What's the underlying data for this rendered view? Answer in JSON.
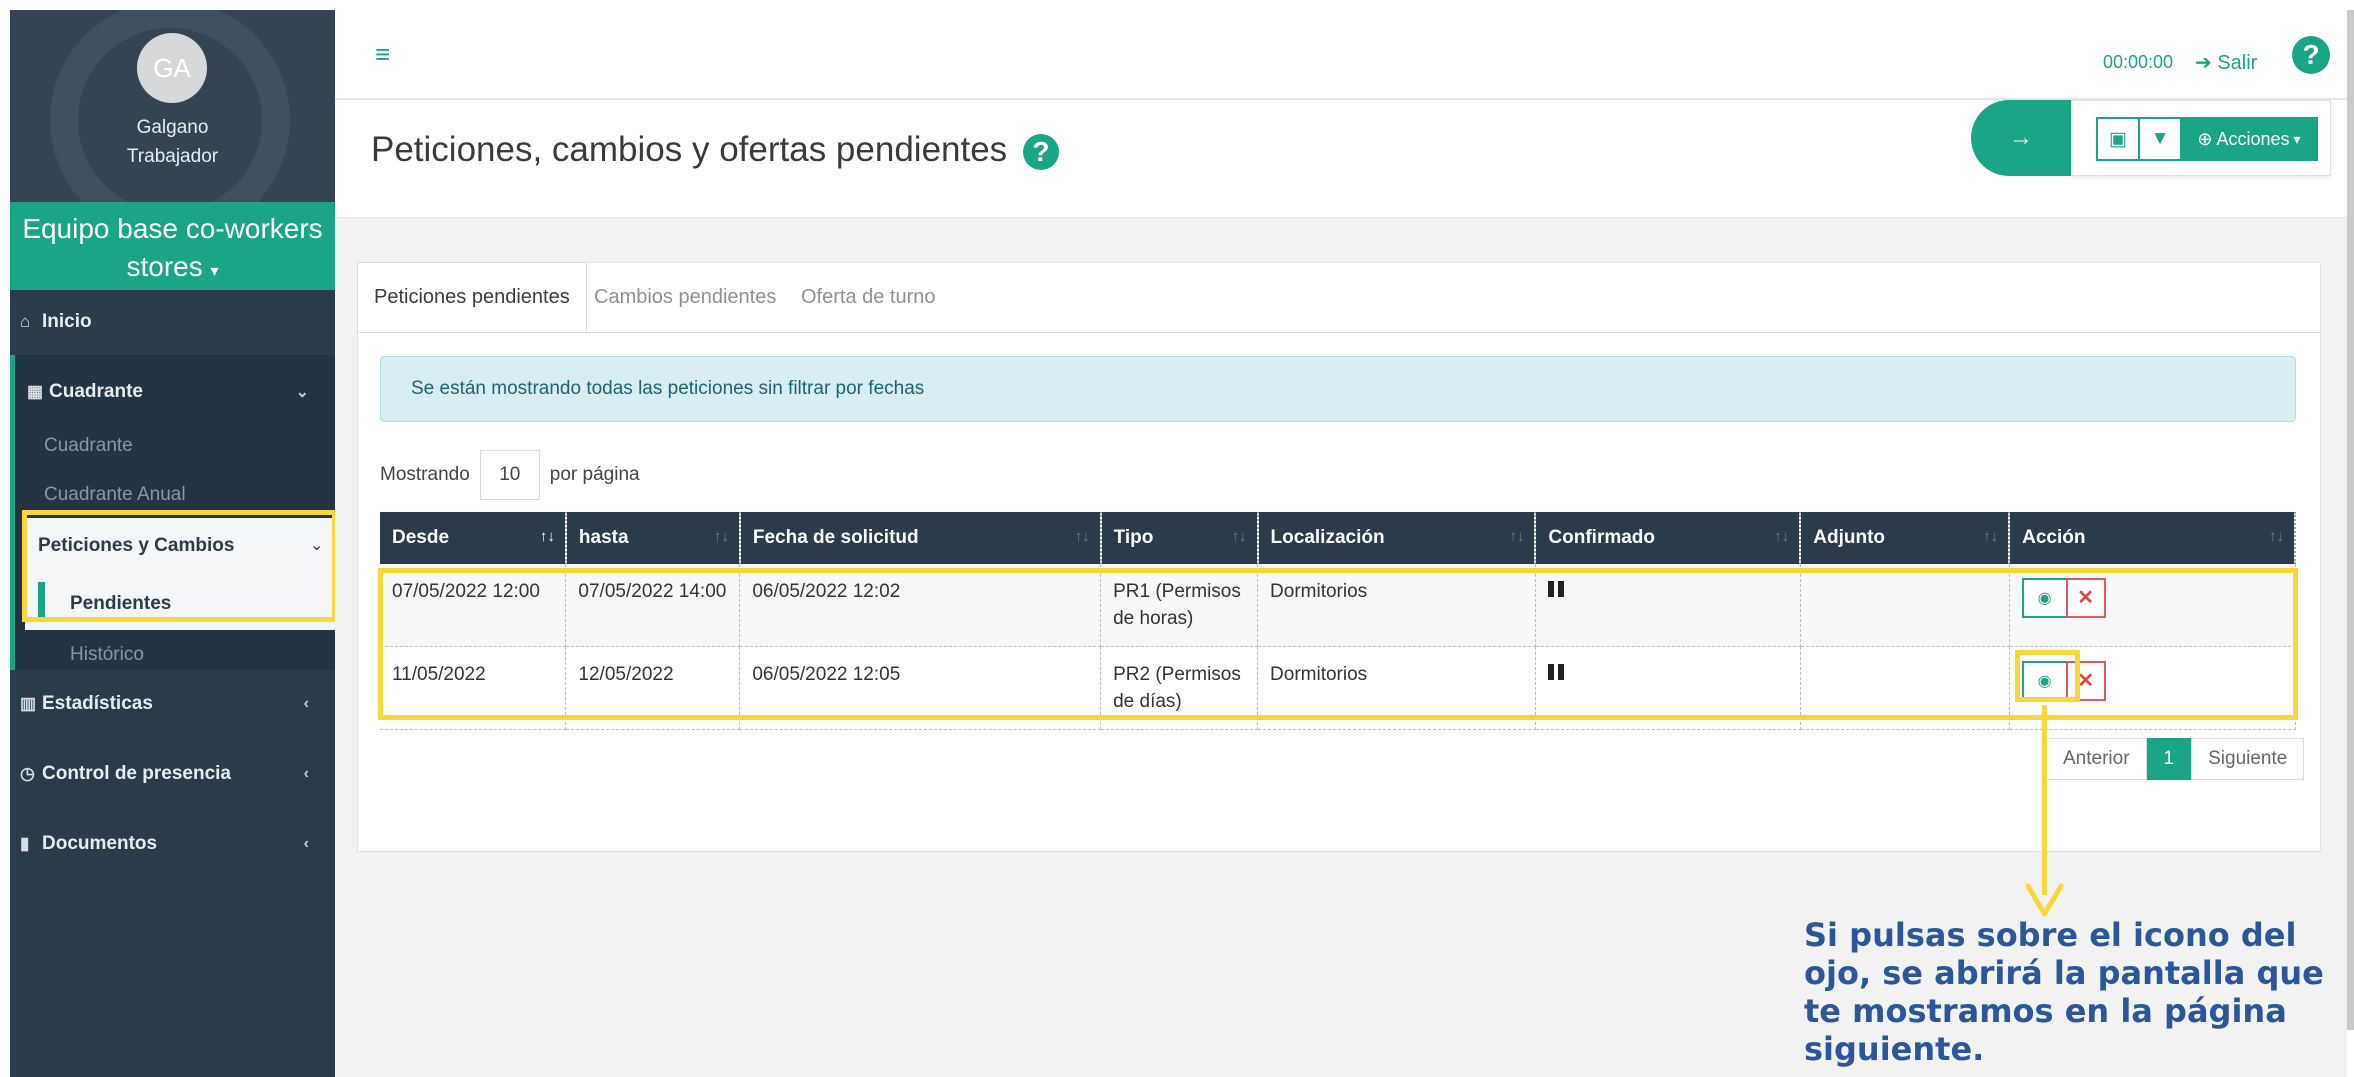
{
  "profile": {
    "initials": "GA",
    "name": "Galgano",
    "role": "Trabajador"
  },
  "team": {
    "label": "Equipo base co-workers stores",
    "caret": "▾"
  },
  "sidebar": {
    "inicio": "Inicio",
    "cuadrante": "Cuadrante",
    "cuadrante_sub": "Cuadrante",
    "cuadrante_anual": "Cuadrante Anual",
    "peticiones": "Peticiones y Cambios",
    "pendientes": "Pendientes",
    "historico": "Histórico",
    "estadisticas": "Estadísticas",
    "control": "Control de presencia",
    "documentos": "Documentos"
  },
  "topbar": {
    "timer": "00:00:00",
    "logout": "Salir",
    "help": "?"
  },
  "page": {
    "title": "Peticiones, cambios y ofertas pendientes",
    "help": "?"
  },
  "toolbar": {
    "actions": "Acciones"
  },
  "tabs": [
    "Peticiones pendientes",
    "Cambios pendientes",
    "Oferta de turno"
  ],
  "alert": "Se están mostrando todas las peticiones sin filtrar por fechas",
  "paging": {
    "prefix": "Mostrando",
    "count": "10",
    "suffix": "por página",
    "prev": "Anterior",
    "current": "1",
    "next": "Siguiente"
  },
  "table": {
    "headers": [
      "Desde",
      "hasta",
      "Fecha de solicitud",
      "Tipo",
      "Localización",
      "Confirmado",
      "Adjunto",
      "Acción"
    ],
    "rows": [
      {
        "desde": "07/05/2022 12:00",
        "hasta": "07/05/2022 14:00",
        "fecha": "06/05/2022 12:02",
        "tipo": "PR1 (Permisos de horas)",
        "loc": "Dormitorios"
      },
      {
        "desde": "11/05/2022",
        "hasta": "12/05/2022",
        "fecha": "06/05/2022 12:05",
        "tipo": "PR2 (Permisos de días)",
        "loc": "Dormitorios"
      }
    ]
  },
  "callout": "Si pulsas sobre el icono del ojo, se abrirá la pantalla que te mostramos en la página siguiente.",
  "colors": {
    "accent": "#19a586",
    "sidebar": "#2c3b4a",
    "highlight": "#f7d73a",
    "callout": "#2b579a"
  }
}
